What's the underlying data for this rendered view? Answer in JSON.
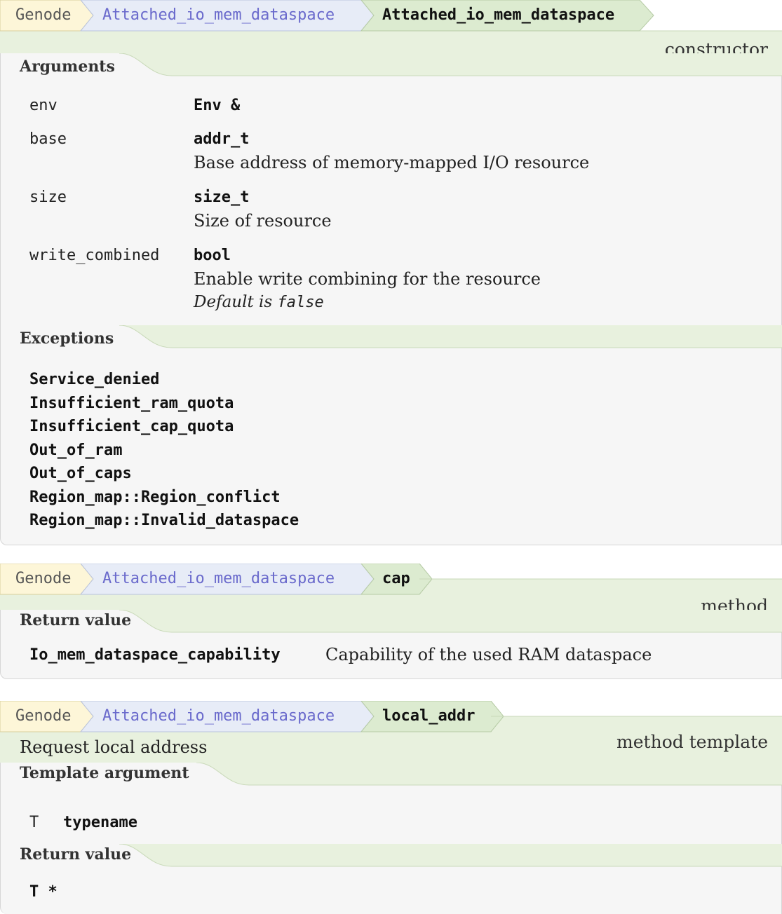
{
  "entries": [
    {
      "breadcrumb": {
        "root": "Genode",
        "class": "Attached_io_mem_dataspace",
        "member": "Attached_io_mem_dataspace"
      },
      "kind": "constructor",
      "arguments_title": "Arguments",
      "arguments": [
        {
          "name": "env",
          "type": "Env &",
          "desc": "",
          "default_prefix": "",
          "default_value": ""
        },
        {
          "name": "base",
          "type": "addr_t",
          "desc": "Base address of memory-mapped I/O resource",
          "default_prefix": "",
          "default_value": ""
        },
        {
          "name": "size",
          "type": "size_t",
          "desc": "Size of resource",
          "default_prefix": "",
          "default_value": ""
        },
        {
          "name": "write_combined",
          "type": "bool",
          "desc": "Enable write combining for the resource",
          "default_prefix": "Default is",
          "default_value": "false"
        }
      ],
      "exceptions_title": "Exceptions",
      "exceptions": [
        "Service_denied",
        "Insufficient_ram_quota",
        "Insufficient_cap_quota",
        "Out_of_ram",
        "Out_of_caps",
        "Region_map::Region_conflict",
        "Region_map::Invalid_dataspace"
      ]
    },
    {
      "breadcrumb": {
        "root": "Genode",
        "class": "Attached_io_mem_dataspace",
        "member": "cap"
      },
      "kind": "method",
      "return_title": "Return value",
      "return_type": "Io_mem_dataspace_capability",
      "return_desc": "Capability of the used RAM dataspace"
    },
    {
      "breadcrumb": {
        "root": "Genode",
        "class": "Attached_io_mem_dataspace",
        "member": "local_addr"
      },
      "kind": "method template",
      "brief": "Request local address",
      "template_title": "Template argument",
      "template_name": "T",
      "template_type": "typename",
      "return_title": "Return value",
      "return_type": "T *"
    }
  ]
}
